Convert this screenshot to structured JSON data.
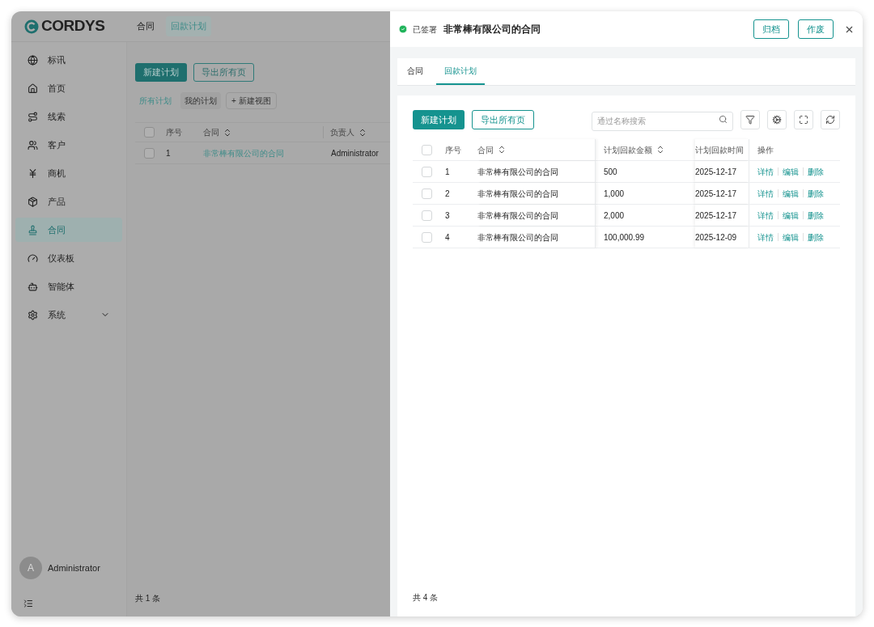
{
  "app": {
    "logo": "CORDYS",
    "top_tabs": [
      {
        "label": "合同",
        "selected": false
      },
      {
        "label": "回款计划",
        "selected": true
      }
    ],
    "sidebar": {
      "items": [
        {
          "label": "标讯",
          "selected": false,
          "kind": "link"
        },
        {
          "label": "首页",
          "selected": false,
          "kind": "link"
        },
        {
          "label": "线索",
          "selected": false,
          "kind": "link"
        },
        {
          "label": "客户",
          "selected": false,
          "kind": "link"
        },
        {
          "label": "商机",
          "selected": false,
          "kind": "link"
        },
        {
          "label": "产品",
          "selected": false,
          "kind": "link"
        },
        {
          "label": "合同",
          "selected": true,
          "kind": "link"
        },
        {
          "label": "仪表板",
          "selected": false,
          "kind": "link"
        },
        {
          "label": "智能体",
          "selected": false,
          "kind": "link"
        },
        {
          "label": "系统",
          "selected": false,
          "kind": "group"
        }
      ],
      "user": {
        "avatar": "A",
        "name": "Administrator"
      }
    },
    "content": {
      "primary_button": "新建计划",
      "export_button": "导出所有页",
      "views": [
        {
          "label": "所有计划",
          "selected": true
        },
        {
          "label": "我的计划",
          "selected": false
        }
      ],
      "new_view": "+ 新建视图",
      "table": {
        "select_all": {
          "checked": false
        },
        "columns": [
          {
            "label": "序号",
            "sortable": false
          },
          {
            "label": "合同",
            "sortable": true
          },
          {
            "label": "负责人",
            "sortable": true
          }
        ],
        "rows": [
          {
            "checked": false,
            "index": "1",
            "contract": "非常棒有限公司的合同",
            "owner": "Administrator"
          }
        ]
      },
      "footer": "共 1 条"
    }
  },
  "drawer": {
    "status": "已签署",
    "title": "非常棒有限公司的合同",
    "actions": [
      "归档",
      "作废"
    ],
    "tabs": [
      {
        "label": "合同",
        "selected": false
      },
      {
        "label": "回款计划",
        "selected": true
      }
    ],
    "primary_button": "新建计划",
    "export_button": "导出所有页",
    "search": {
      "placeholder": "通过名称搜索"
    },
    "table": {
      "select_all": {
        "checked": false
      },
      "columns": [
        {
          "label": "序号",
          "sortable": false
        },
        {
          "label": "合同",
          "sortable": true
        },
        {
          "label": "计划回款金额",
          "sortable": true
        },
        {
          "label": "计划回款时间",
          "sortable": false
        },
        {
          "label": "操作",
          "sortable": false
        }
      ],
      "rows": [
        {
          "checked": false,
          "index": "1",
          "contract": "非常棒有限公司的合同",
          "amount": "500",
          "date": "2025-12-17",
          "actions": [
            "详情",
            "编辑",
            "删除"
          ]
        },
        {
          "checked": false,
          "index": "2",
          "contract": "非常棒有限公司的合同",
          "amount": "1,000",
          "date": "2025-12-17",
          "actions": [
            "详情",
            "编辑",
            "删除"
          ]
        },
        {
          "checked": false,
          "index": "3",
          "contract": "非常棒有限公司的合同",
          "amount": "2,000",
          "date": "2025-12-17",
          "actions": [
            "详情",
            "编辑",
            "删除"
          ]
        },
        {
          "checked": false,
          "index": "4",
          "contract": "非常棒有限公司的合同",
          "amount": "100,000.99",
          "date": "2025-12-09",
          "actions": [
            "详情",
            "编辑",
            "删除"
          ]
        }
      ]
    },
    "footer": "共 4 条"
  }
}
